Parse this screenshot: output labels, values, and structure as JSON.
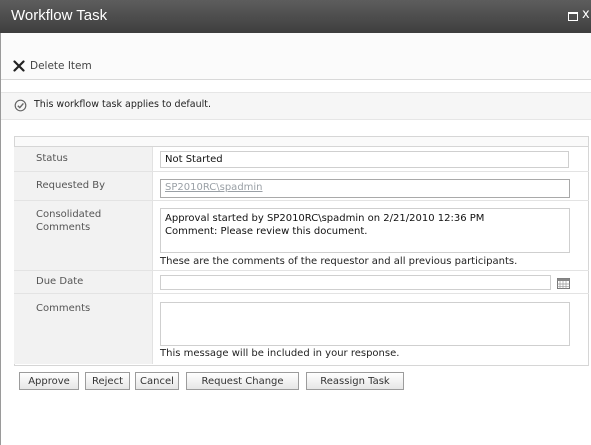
{
  "window": {
    "title": "Workflow Task",
    "maximize_icon": "maximize-icon",
    "close_glyph": "x"
  },
  "toolbar": {
    "delete_label": "Delete Item",
    "delete_icon": "delete-x-icon"
  },
  "notice": {
    "text": "This workflow task applies to default.",
    "icon": "check-circle-icon"
  },
  "form": {
    "status": {
      "label": "Status",
      "value": "Not Started"
    },
    "requested_by": {
      "label": "Requested By",
      "value": "SP2010RC\\spadmin"
    },
    "consolidated_comments": {
      "label_line1": "Consolidated",
      "label_line2": "Comments",
      "line1": "Approval started by SP2010RC\\spadmin on 2/21/2010 12:36 PM",
      "line2": "Comment: Please review this document.",
      "hint": "These are the comments of the requestor and all previous participants."
    },
    "due_date": {
      "label": "Due Date",
      "value": "",
      "icon": "calendar-icon"
    },
    "comments": {
      "label": "Comments",
      "value": "",
      "hint": "This message will be included in your response."
    }
  },
  "buttons": {
    "approve": "Approve",
    "reject": "Reject",
    "cancel": "Cancel",
    "request_change": "Request Change",
    "reassign_task": "Reassign Task"
  },
  "colors": {
    "titlebar": "#4a4a4a",
    "label_background": "#f2f2f2",
    "link_text": "#9aa0a6"
  }
}
